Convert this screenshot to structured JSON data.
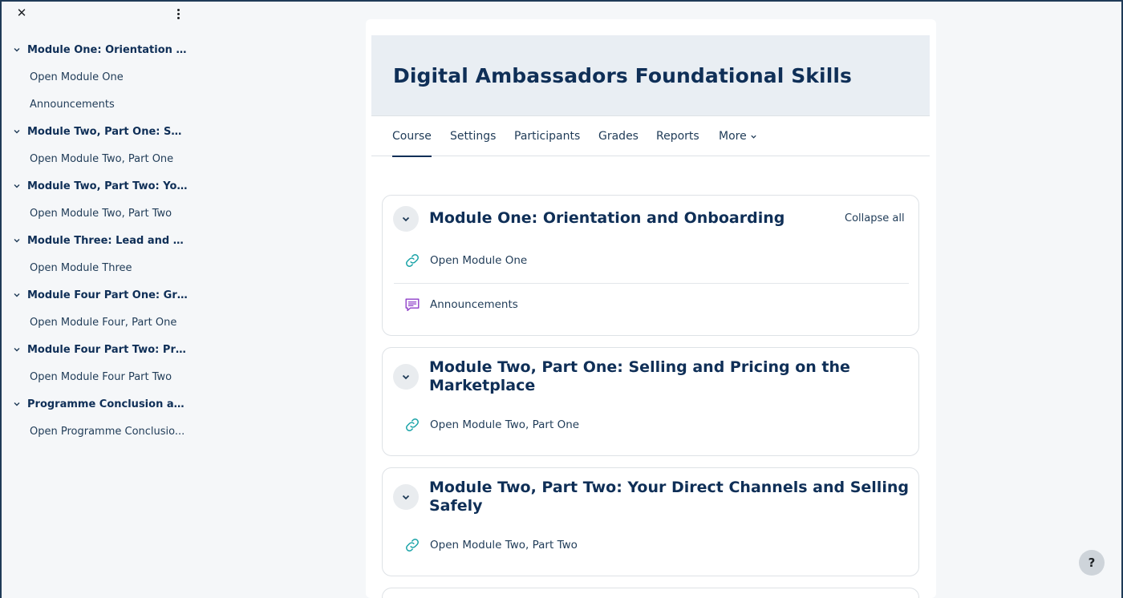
{
  "drawer": {
    "close_glyph": "✕",
    "sections": [
      {
        "title": "Module One: Orientation an...",
        "items": [
          "Open Module One",
          "Announcements"
        ]
      },
      {
        "title": "Module Two, Part One: Selli...",
        "items": [
          "Open Module Two, Part One"
        ]
      },
      {
        "title": "Module Two, Part Two: Your...",
        "items": [
          "Open Module Two, Part Two"
        ]
      },
      {
        "title": "Module Three: Lead and Em...",
        "items": [
          "Open Module Three"
        ]
      },
      {
        "title": "Module Four Part One: Gro...",
        "items": [
          "Open Module Four, Part One"
        ]
      },
      {
        "title": "Module Four Part Two: Prici...",
        "items": [
          "Open Module Four Part Two"
        ]
      },
      {
        "title": "Programme Conclusion and...",
        "items": [
          "Open Programme Conclusio..."
        ]
      }
    ]
  },
  "course": {
    "title": "Digital Ambassadors Foundational Skills"
  },
  "tabs": [
    "Course",
    "Settings",
    "Participants",
    "Grades",
    "Reports",
    "More"
  ],
  "active_tab": "Course",
  "sections": [
    {
      "title": "Module One: Orientation and Onboarding",
      "collapse_all": "Collapse all",
      "activities": [
        {
          "label": "Open Module One",
          "icon": "link-icon"
        },
        {
          "label": "Announcements",
          "icon": "forum-icon"
        }
      ]
    },
    {
      "title_line1": "Module Two, Part One: Selling and Pricing on the",
      "title_line2": "Marketplace",
      "activities": [
        {
          "label": "Open Module Two, Part One",
          "icon": "link-icon"
        }
      ]
    },
    {
      "title_line1": "Module Two, Part Two: Your Direct Channels and Selling",
      "title_line2": "Safely",
      "activities": [
        {
          "label": "Open Module Two, Part Two",
          "icon": "link-icon"
        }
      ]
    }
  ],
  "help": "?",
  "colors": {
    "title_navy": "#0f2f57",
    "link_teal": "#16a2a6",
    "forum_purple": "#8e3fc9",
    "header_bg": "#e9eef3"
  }
}
